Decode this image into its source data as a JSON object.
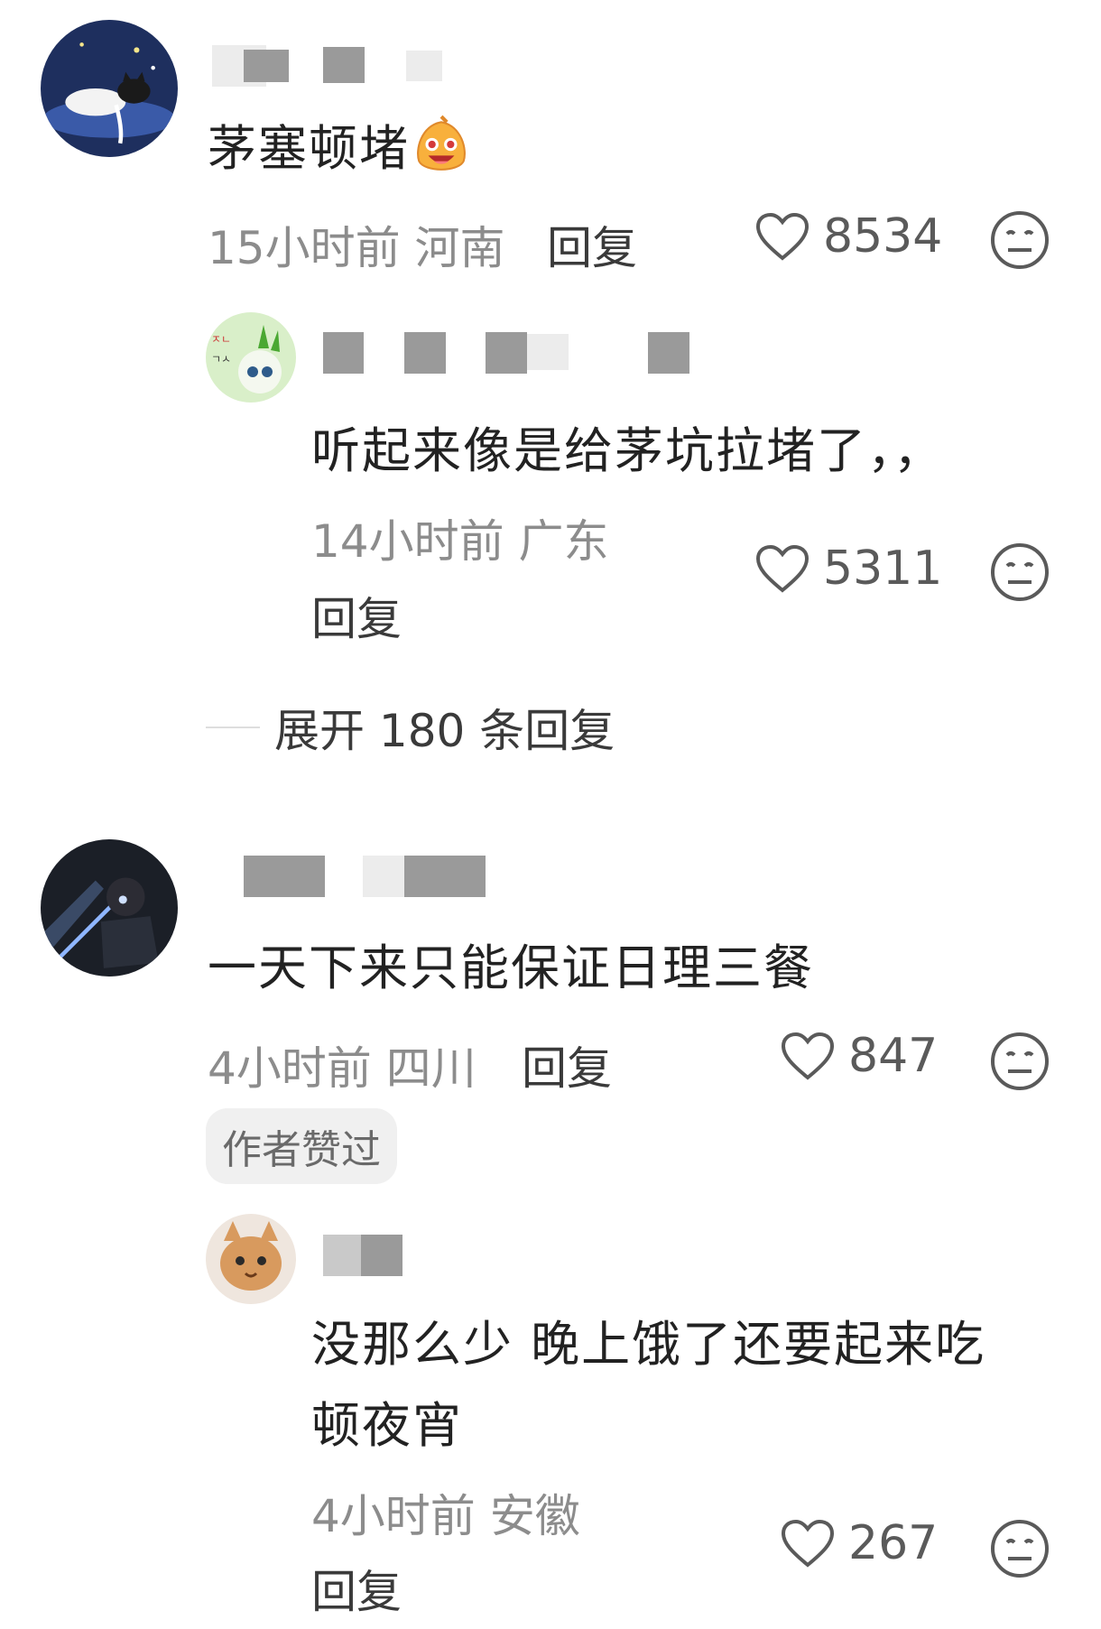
{
  "comments": [
    {
      "text": "茅塞顿堵",
      "time": "15小时前",
      "location": "河南",
      "reply_label": "回复",
      "likes": "8534",
      "replies": [
        {
          "text": "听起来像是给茅坑拉堵了，，",
          "time": "14小时前",
          "location": "广东",
          "reply_label": "回复",
          "likes": "5311"
        }
      ],
      "expand_label": "展开 180 条回复"
    },
    {
      "text": "一天下来只能保证日理三餐",
      "time": "4小时前",
      "location": "四川",
      "reply_label": "回复",
      "likes": "847",
      "badge": "作者赞过",
      "replies": [
        {
          "text_line1": "没那么少 晚上饿了还要起来吃",
          "text_line2": "顿夜宵",
          "time": "4小时前",
          "location": "安徽",
          "reply_label": "回复",
          "likes": "267"
        }
      ]
    }
  ],
  "icons": {
    "like": "heart-outline-icon",
    "dislike": "neutral-face-icon",
    "emoji": "laughing-emoji-icon"
  },
  "colors": {
    "text": "#222222",
    "meta": "#8c8c8c",
    "icon": "#5a5a5a"
  }
}
